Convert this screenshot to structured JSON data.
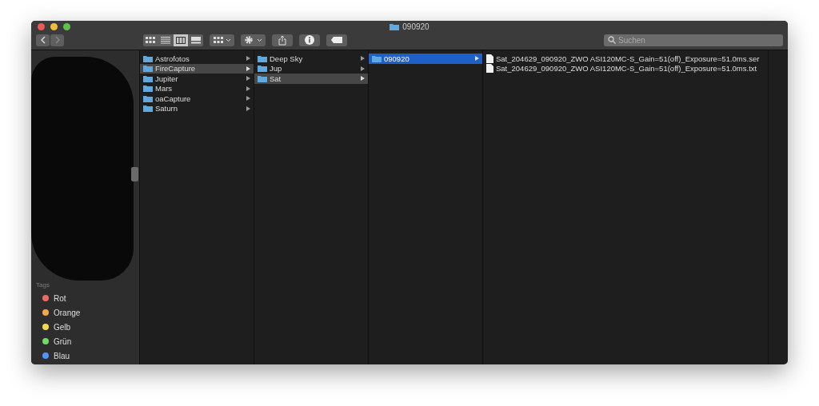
{
  "window": {
    "title": "090920"
  },
  "toolbar": {
    "view_modes": [
      {
        "kind": "icons",
        "selected": false
      },
      {
        "kind": "list",
        "selected": false
      },
      {
        "kind": "columns",
        "selected": true
      },
      {
        "kind": "gallery",
        "selected": false
      }
    ],
    "search": {
      "placeholder": "Suchen"
    }
  },
  "sidebar": {
    "tags_title": "Tags",
    "tags": [
      {
        "label": "Rot",
        "color": "#ee6a64"
      },
      {
        "label": "Orange",
        "color": "#f4a84c"
      },
      {
        "label": "Gelb",
        "color": "#f3d94f"
      },
      {
        "label": "Grün",
        "color": "#6fda6a"
      },
      {
        "label": "Blau",
        "color": "#4f95f3"
      }
    ]
  },
  "columns": [
    [
      {
        "kind": "folder",
        "name": "Astrofotos",
        "selected": false
      },
      {
        "kind": "folder",
        "name": "FireCapture",
        "selected": true
      },
      {
        "kind": "folder",
        "name": "Jupiter",
        "selected": false
      },
      {
        "kind": "folder",
        "name": "Mars",
        "selected": false
      },
      {
        "kind": "folder",
        "name": "oaCapture",
        "selected": false
      },
      {
        "kind": "folder",
        "name": "Saturn",
        "selected": false
      }
    ],
    [
      {
        "kind": "folder",
        "name": "Deep Sky",
        "selected": false
      },
      {
        "kind": "folder",
        "name": "Jup",
        "selected": false
      },
      {
        "kind": "folder",
        "name": "Sat",
        "selected": true
      }
    ],
    [
      {
        "kind": "folder",
        "name": "090920",
        "selected": true
      }
    ],
    [
      {
        "kind": "file",
        "name": "Sat_204629_090920_ZWO ASI120MC-S_Gain=51(off)_Exposure=51.0ms.ser",
        "selected": false
      },
      {
        "kind": "file",
        "name": "Sat_204629_090920_ZWO ASI120MC-S_Gain=51(off)_Exposure=51.0ms.txt",
        "selected": false
      }
    ]
  ]
}
